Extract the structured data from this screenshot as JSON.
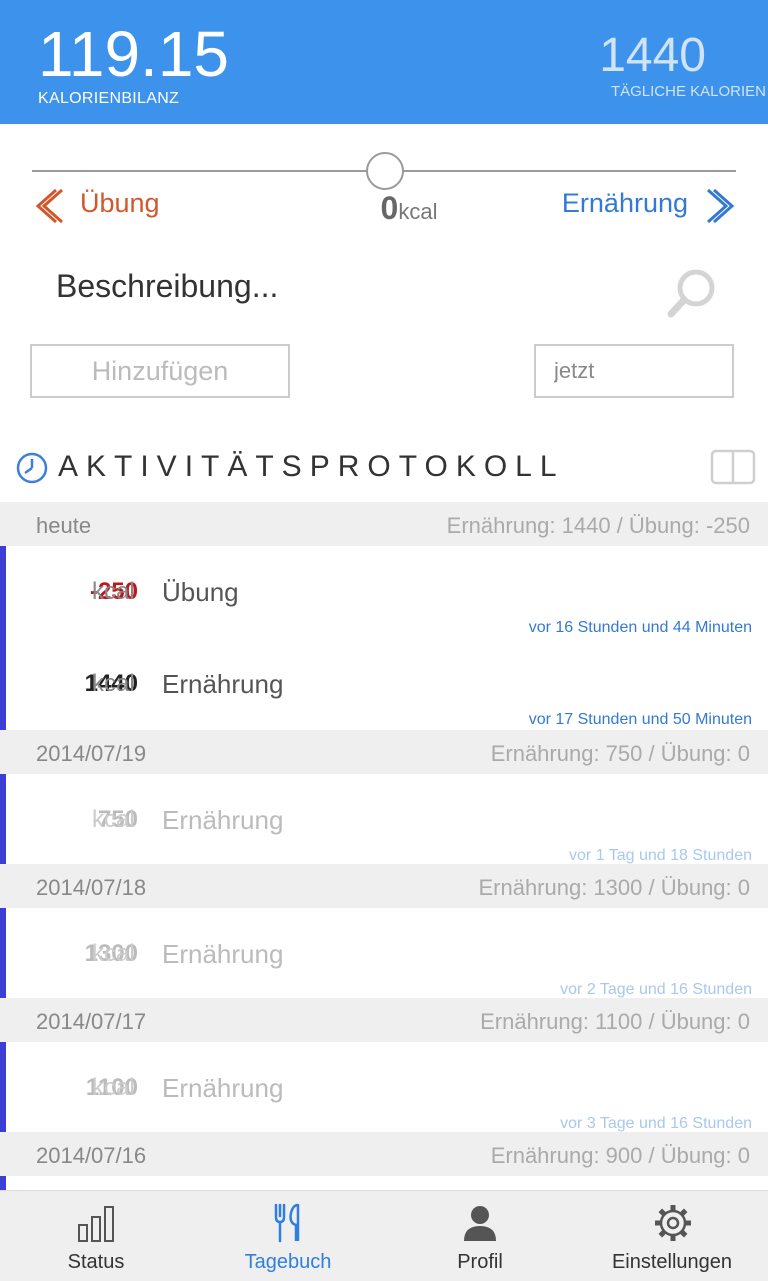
{
  "header": {
    "balance_value": "119.15",
    "balance_label": "KALORIENBILANZ",
    "daily_value": "1440",
    "daily_label": "TÄGLICHE KALORIEN",
    "color": "#3d93eb"
  },
  "entry_form": {
    "exercise_label": "Übung",
    "food_label": "Ernährung",
    "kcal_value": "0",
    "kcal_unit": "kcal",
    "description_placeholder": "Beschreibung...",
    "add_button": "Hinzufügen",
    "time_value": "jetzt"
  },
  "log": {
    "title": "AKTIVITÄTSPROTOKOLL",
    "days": [
      {
        "date": "heute",
        "summary": "Ernährung: 1440 / Übung: -250",
        "items": [
          {
            "amount": "-250",
            "unit": "kcal",
            "type": "Übung",
            "ago": "vor 16 Stunden und 44 Minuten",
            "color": "#c0161b",
            "faded": false
          },
          {
            "amount": "1440",
            "unit": "kcal",
            "type": "Ernährung",
            "ago": "vor 17 Stunden und 50 Minuten",
            "color": "#222222",
            "faded": false
          }
        ]
      },
      {
        "date": "2014/07/19",
        "summary": "Ernährung: 750 / Übung: 0",
        "items": [
          {
            "amount": "750",
            "unit": "kcal",
            "type": "Ernährung",
            "ago": "vor 1 Tag und 18 Stunden",
            "color": "#bbbbbb",
            "faded": true
          }
        ]
      },
      {
        "date": "2014/07/18",
        "summary": "Ernährung: 1300 / Übung: 0",
        "items": [
          {
            "amount": "1300",
            "unit": "kcal",
            "type": "Ernährung",
            "ago": "vor 2 Tage und 16 Stunden",
            "color": "#bbbbbb",
            "faded": true
          }
        ]
      },
      {
        "date": "2014/07/17",
        "summary": "Ernährung: 1100 / Übung: 0",
        "items": [
          {
            "amount": "1100",
            "unit": "kcal",
            "type": "Ernährung",
            "ago": "vor 3 Tage und 16 Stunden",
            "color": "#bbbbbb",
            "faded": true
          }
        ]
      },
      {
        "date": "2014/07/16",
        "summary": "Ernährung: 900 / Übung: 0",
        "items": []
      }
    ]
  },
  "nav": {
    "items": [
      {
        "label": "Status",
        "icon": "bar-chart-icon",
        "active": false
      },
      {
        "label": "Tagebuch",
        "icon": "fork-knife-icon",
        "active": true
      },
      {
        "label": "Profil",
        "icon": "person-icon",
        "active": false
      },
      {
        "label": "Einstellungen",
        "icon": "gear-icon",
        "active": false
      }
    ],
    "active_color": "#2f7fe0"
  }
}
